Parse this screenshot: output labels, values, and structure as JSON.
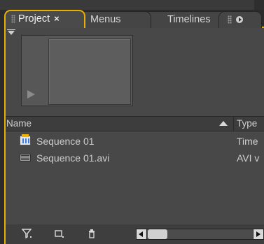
{
  "tabs": [
    {
      "label": "Project",
      "active": true,
      "closable": true,
      "close_glyph": "×"
    },
    {
      "label": "Menus"
    },
    {
      "label": "Timelines"
    }
  ],
  "panel": {
    "list": {
      "columns": {
        "name": "Name",
        "type": "Type"
      },
      "rows": [
        {
          "name": "Sequence 01",
          "type": "Time",
          "icon": "sequence-icon"
        },
        {
          "name": "Sequence 01.avi",
          "type": "AVI v",
          "icon": "video-clip-icon"
        }
      ]
    },
    "toolbar": {
      "filter_icon": "filter-icon",
      "new_bin_icon": "new-bin-icon",
      "delete_icon": "trash-icon"
    }
  },
  "colors": {
    "accent": "#e7b000",
    "panel_bg": "#484848",
    "header_bg": "#3d3d3d"
  }
}
